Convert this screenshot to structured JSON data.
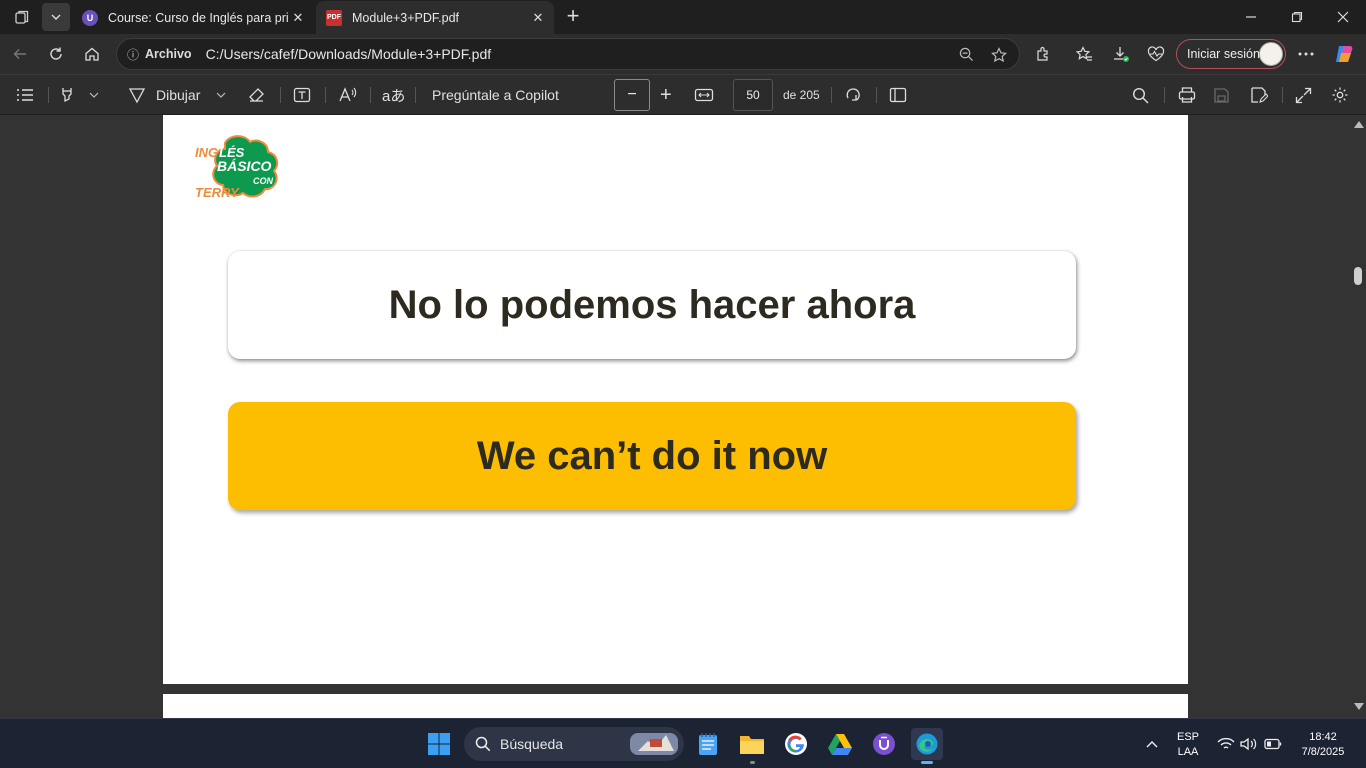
{
  "browser": {
    "tabs": [
      {
        "title": "Course: Curso de Inglés para principiantes",
        "favicon": "udemy-icon",
        "active": false
      },
      {
        "title": "Module+3+PDF.pdf",
        "favicon": "pdf-icon",
        "active": true
      }
    ],
    "address": {
      "scheme_label": "Archivo",
      "url": "C:/Users/cafef/Downloads/Module+3+PDF.pdf"
    },
    "signin_label": "Iniciar sesión"
  },
  "pdf_toolbar": {
    "draw_label": "Dibujar",
    "copilot_label": "Pregúntale a Copilot",
    "zoom_out_symbol": "−",
    "zoom_in_symbol": "+",
    "page_current": "50",
    "page_total": "de 205"
  },
  "document": {
    "logo": {
      "line1": "ING",
      "line2": "LÉS",
      "line3": "BÁSICO",
      "line4": "TERRY",
      "line5": "CON"
    },
    "card1_text": "No lo podemos hacer ahora",
    "card2_text": "We can’t do it now",
    "colors": {
      "yellow": "#fdbd00",
      "logo_green": "#0e9a4e",
      "logo_orange": "#f08a3c"
    }
  },
  "taskbar": {
    "search_placeholder": "Búsqueda",
    "lang_line1": "ESP",
    "lang_line2": "LAA",
    "time": "18:42",
    "date": "7/8/2025"
  }
}
